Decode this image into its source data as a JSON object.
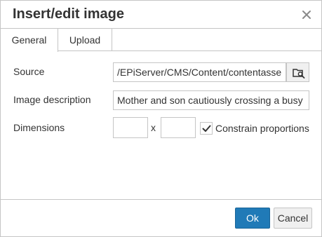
{
  "dialog": {
    "title": "Insert/edit image",
    "close_icon": "close-icon"
  },
  "tabs": [
    {
      "label": "General",
      "active": true
    },
    {
      "label": "Upload",
      "active": false
    }
  ],
  "form": {
    "source": {
      "label": "Source",
      "value": "/EPiServer/CMS/Content/contentasse",
      "browse_icon": "folder-search-icon"
    },
    "description": {
      "label": "Image description",
      "value": "Mother and son cautiously crossing a busy"
    },
    "dimensions": {
      "label": "Dimensions",
      "width": "",
      "separator": "x",
      "height": "",
      "constrain_label": "Constrain proportions",
      "constrain_checked": true
    }
  },
  "footer": {
    "ok_label": "Ok",
    "cancel_label": "Cancel"
  },
  "colors": {
    "primary": "#207ab7",
    "border": "#c5c5c5",
    "text": "#333333"
  }
}
